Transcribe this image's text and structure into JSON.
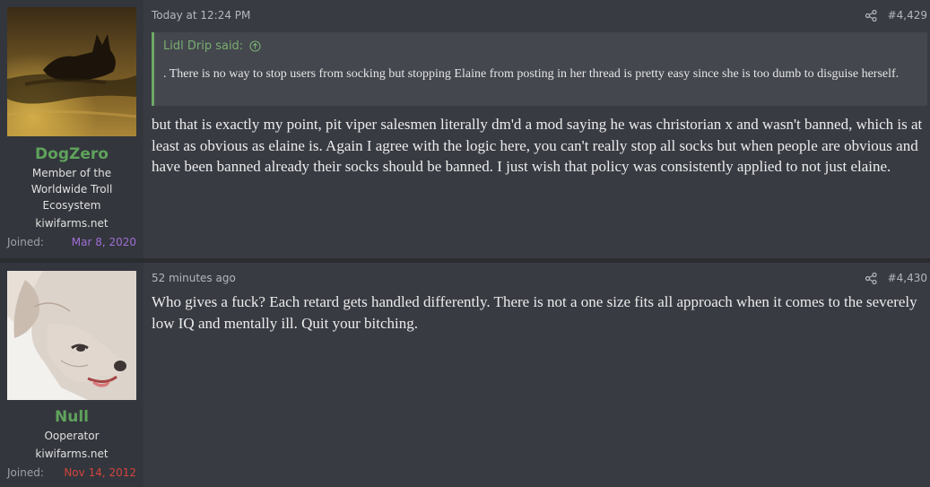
{
  "posts": [
    {
      "username": "DogZero",
      "user_title_lines": [
        "Member of the",
        "Worldwide Troll",
        "Ecosystem"
      ],
      "site": "kiwifarms.net",
      "joined_label": "Joined:",
      "joined_date": "Mar 8, 2020",
      "joined_color": "#a06ed6",
      "timestamp": "Today at 12:24 PM",
      "post_number": "#4,429",
      "quote": {
        "author": "Lidl Drip said:",
        "text": ". There is no way to stop users from socking but stopping Elaine from posting in her thread is pretty easy since she is too dumb to disguise herself."
      },
      "message": "but that is exactly my point, pit viper salesmen literally dm'd a mod saying he was christorian x and wasn't banned, which is at least as obvious as elaine is. Again I agree with the logic here, you can't really stop all socks but when people are obvious and have been banned already their socks should be banned. I just wish that policy was consistently applied to not just elaine."
    },
    {
      "username": "Null",
      "user_title_lines": [
        "Ooperator"
      ],
      "site": "kiwifarms.net",
      "joined_label": "Joined:",
      "joined_date": "Nov 14, 2012",
      "joined_color": "#d4443f",
      "timestamp": "52 minutes ago",
      "post_number": "#4,430",
      "message": "Who gives a fuck? Each retard gets handled differently. There is not a one size fits all approach when it comes to the severely low IQ and mentally ill. Quit your bitching."
    }
  ],
  "icons": [
    "share-icon",
    "quote-jump-icon",
    "avatar-dog-photo",
    "avatar-dog-cartoon"
  ]
}
